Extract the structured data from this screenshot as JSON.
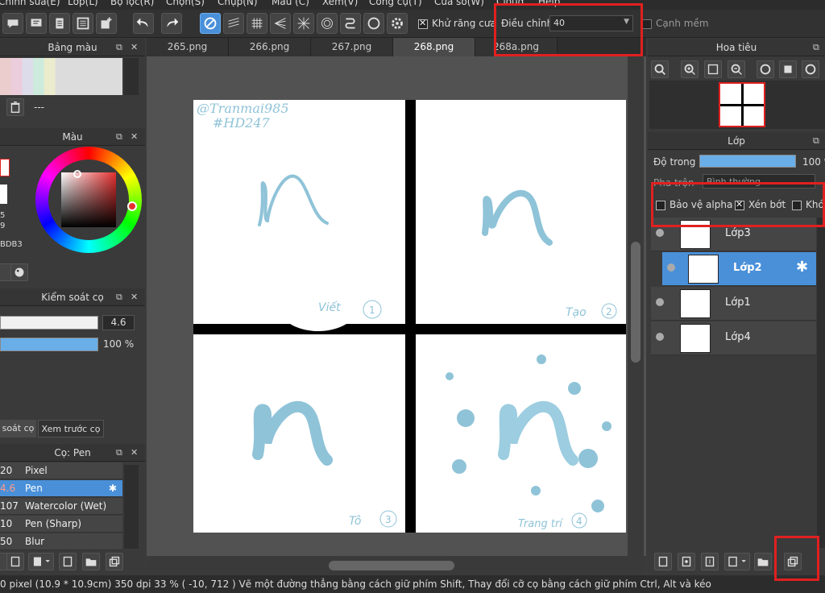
{
  "menu": [
    "Chỉnh sửa(E)",
    "Lớp(L)",
    "Bộ lọc(R)",
    "Chọn(S)",
    "Chụp(N)",
    "Màu (C)",
    "Xem(V)",
    "Công cụ(T)",
    "Cửa sổ(W)",
    "Cloud",
    "Help"
  ],
  "toolbar": {
    "antialias_label": "Khử răng cưa",
    "adjust_label": "Điều chỉnh",
    "adjust_value": "40",
    "soft_edge_label": "Cạnh mềm"
  },
  "tabs": [
    "265.png",
    "266.png",
    "267.png",
    "268.png",
    "268a.png"
  ],
  "active_tab": "268.png",
  "panels": {
    "palette_title": "Bảng màu",
    "palette_empty": "---",
    "color_title": "Màu",
    "color_values": [
      "5",
      "9",
      "BDB3"
    ],
    "brush_control_title": "Kiểm soát cọ",
    "brush_size": "4.6",
    "brush_opacity": "100 %",
    "brush_tab1": "soát cọ",
    "brush_tab2": "Xem trước cọ",
    "brush_list_title": "Cọ: Pen",
    "brushes": [
      {
        "size": "20",
        "name": "Pixel"
      },
      {
        "size": "4.6",
        "name": "Pen"
      },
      {
        "size": "107",
        "name": "Watercolor (Wet)"
      },
      {
        "size": "10",
        "name": "Pen (Sharp)"
      },
      {
        "size": "50",
        "name": "Blur"
      }
    ],
    "nav_title": "Hoa tiêu",
    "layer_title": "Lớp",
    "opacity_label": "Độ trong",
    "opacity_value": "100 %",
    "blend_label": "Pha trộn",
    "blend_value": "Bình thường",
    "protect_alpha": "Bảo vệ alpha",
    "clipping": "Xén bớt",
    "lock": "Khóa",
    "layers": [
      "Lớp3",
      "Lớp2",
      "Lớp1",
      "Lớp4"
    ]
  },
  "artwork": {
    "sig1": "@Tranmai985",
    "sig2": "#HD247",
    "q1": "Viết",
    "q1n": "1",
    "q2": "Tạo",
    "q2n": "2",
    "q3": "Tô",
    "q3n": "3",
    "q4": "Trang trí",
    "q4n": "4"
  },
  "status": "0 pixel  (10.9 * 10.9cm)  350 dpi  33 %  ( -10, 712 )  Vẽ một đường thẳng bằng cách giữ phím Shift, Thay đổi cỡ cọ bằng cách giữ phím Ctrl, Alt và kéo",
  "colors": {
    "accent": "#4a90d9",
    "highlight": "#e02020",
    "stroke": "#8fc3d8"
  }
}
